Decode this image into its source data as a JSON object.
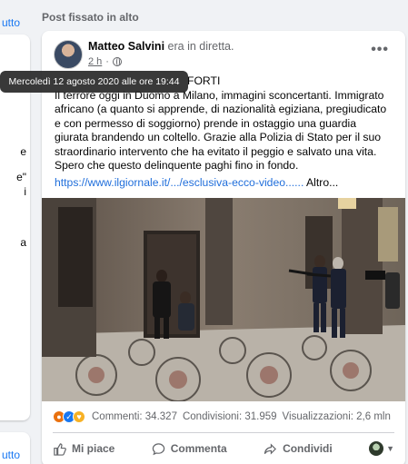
{
  "left": {
    "top_link": "utto",
    "fragments": [
      "e",
      "e\"",
      "i",
      "a"
    ],
    "bottom_link": "utto"
  },
  "section_title": "Post fissato in alto",
  "post": {
    "author": "Matteo Salvini",
    "action": "era in diretta.",
    "time": "2 h",
    "more": "•••",
    "tooltip": "Mercoledì 12 agosto 2020 alle ore 19:44",
    "text_first": "FORTI",
    "text": "Il terrore oggi in Duomo a Milano, immagini sconcertanti. Immigrato africano (a quanto si apprende, di nazionalità egiziana, pregiudicato e con permesso di soggiorno) prende in ostaggio una guardia giurata brandendo un coltello. Grazie alla Polizia di Stato per il suo straordinario intervento che ha evitato il peggio e salvato una vita. Spero che questo delinquente paghi fino in fondo.",
    "link": "https://www.ilgiornale.it/.../esclusiva-ecco-video......",
    "link_more": "Altro...",
    "comments": "Commenti: 34.327",
    "shares": "Condivisioni: 31.959",
    "views": "Visualizzazioni: 2,6 mln",
    "like_label": "Mi piace",
    "comment_label": "Commenta",
    "share_label": "Condividi"
  },
  "colors": {
    "link": "#216fdb",
    "angry": "#e9710f",
    "like": "#1877f2",
    "care": "#f7b125"
  }
}
